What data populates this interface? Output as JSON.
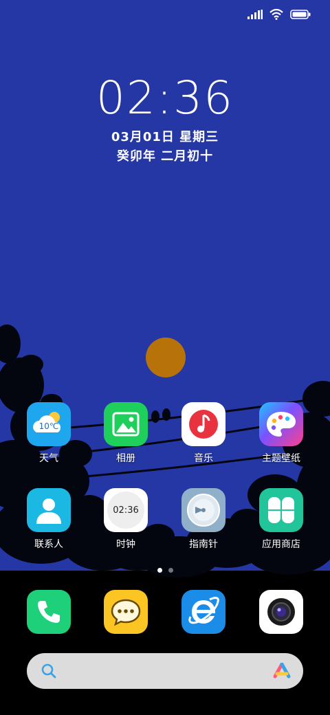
{
  "status_bar": {
    "signal_icon": "signal-bars-icon",
    "wifi_icon": "wifi-icon",
    "battery_icon": "battery-icon"
  },
  "lockclock": {
    "time": "02:36",
    "date": "03月01日 星期三",
    "lunar": "癸卯年 二月初十"
  },
  "apps": [
    {
      "label": "天气",
      "icon": "weather-icon",
      "temp": "10℃"
    },
    {
      "label": "相册",
      "icon": "gallery-icon"
    },
    {
      "label": "音乐",
      "icon": "music-icon"
    },
    {
      "label": "主题壁纸",
      "icon": "theme-palette-icon"
    },
    {
      "label": "联系人",
      "icon": "contacts-icon"
    },
    {
      "label": "时钟",
      "icon": "clock-icon",
      "time": "02:36"
    },
    {
      "label": "指南针",
      "icon": "compass-icon"
    },
    {
      "label": "应用商店",
      "icon": "app-store-icon"
    }
  ],
  "pager": {
    "total": 2,
    "current": 1
  },
  "dock": [
    {
      "icon": "phone-icon"
    },
    {
      "icon": "messages-icon"
    },
    {
      "icon": "browser-icon"
    },
    {
      "icon": "camera-icon"
    }
  ],
  "search_bar": {
    "search_icon": "search-icon",
    "assistant_icon": "assistant-logo-icon"
  },
  "colors": {
    "wallpaper": "#2437a4",
    "moon": "#b7730a",
    "weather": "#1ea6ee",
    "gallery": "#1fcf5c",
    "music_red": "#e8323f",
    "contacts": "#1bb8e4",
    "compass": "#8fb0c8",
    "app_store": "#22c49a",
    "phone": "#1fd07a",
    "messages": "#fbc524",
    "browser": "#1b8de8"
  }
}
